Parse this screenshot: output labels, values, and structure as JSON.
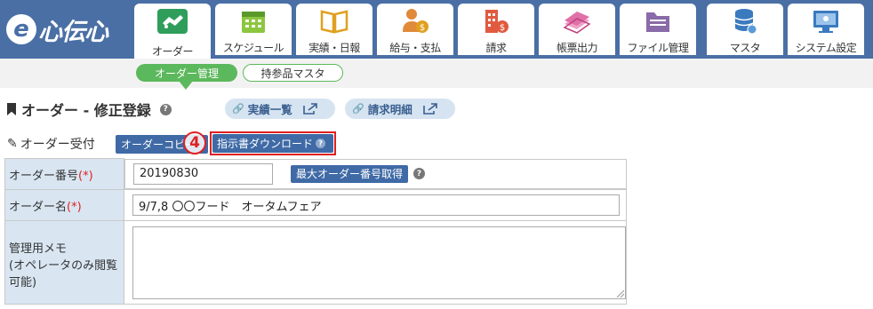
{
  "app": {
    "logo_mark": "e",
    "logo_text": "心伝心"
  },
  "nav_tabs": [
    {
      "label": "オーダー",
      "icon": "handshake-icon",
      "active": true
    },
    {
      "label": "スケジュール",
      "icon": "calendar-icon",
      "active": false
    },
    {
      "label": "実績・日報",
      "icon": "open-book-icon",
      "active": false
    },
    {
      "label": "給与・支払",
      "icon": "person-money-icon",
      "active": false
    },
    {
      "label": "請求",
      "icon": "building-money-icon",
      "active": false
    },
    {
      "label": "帳票出力",
      "icon": "document-stack-icon",
      "active": false
    },
    {
      "label": "ファイル管理",
      "icon": "folder-icon",
      "active": false
    },
    {
      "label": "マスタ",
      "icon": "database-icon",
      "active": false
    },
    {
      "label": "システム設定",
      "icon": "monitor-settings-icon",
      "active": false
    }
  ],
  "subnav": {
    "active": "オーダー管理",
    "inactive": "持参品マスタ"
  },
  "page": {
    "title": "オーダー - 修正登録",
    "help": "?"
  },
  "links": {
    "results_list": "実績一覧",
    "billing_detail": "請求明細"
  },
  "reception": {
    "label": "オーダー受付",
    "copy_button": "オーダーコピー",
    "download_button": "指示書ダウンロード",
    "step_number": "4"
  },
  "form": {
    "order_number_label": "オーダー番号",
    "required_mark": "(*)",
    "order_number_value": "20190830",
    "max_number_button": "最大オーダー番号取得",
    "order_name_label": "オーダー名",
    "order_name_value": "9/7,8 〇〇フード　オータムフェア",
    "memo_label": "管理用メモ\n(オペレータのみ閲覧可能)",
    "memo_value": ""
  },
  "colors": {
    "header_bg": "#4a6fa5",
    "accent_green": "#5cb85c",
    "button_blue": "#3f6aa6",
    "highlight_red": "#e02020",
    "label_cell_bg": "#d9e6f2"
  }
}
